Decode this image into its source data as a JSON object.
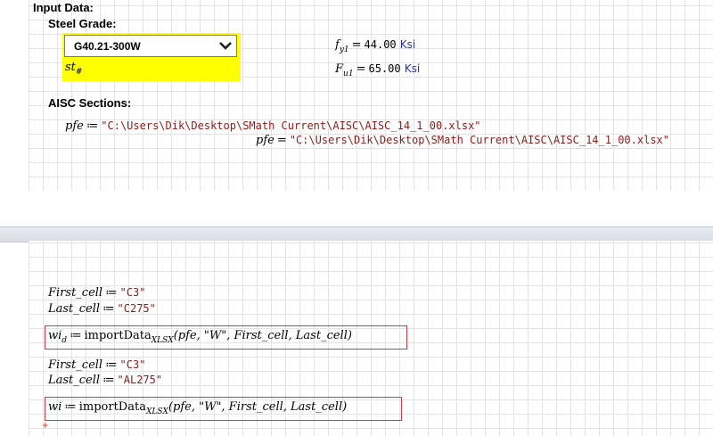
{
  "input_section": {
    "heading": "Input Data:",
    "steel_grade_label": "Steel Grade:",
    "steel_grade_value": "G40.21-300W",
    "st_var": "st",
    "st_sub": "#",
    "fy": {
      "name": "f",
      "sub": "y1",
      "value": "44.00",
      "unit": "Ksi"
    },
    "fu": {
      "name": "F",
      "sub": "u1",
      "value": "65.00",
      "unit": "Ksi"
    },
    "aisc_label": "AISC Sections:",
    "pfe_def": {
      "name": "pfe",
      "op": "≔",
      "value": "\"C:\\Users\\Dik\\Desktop\\SMath Current\\AISC\\AISC_14_1_00.xlsx\""
    },
    "pfe_eval": {
      "name": "pfe",
      "op": "=",
      "value": "\"C:\\Users\\Dik\\Desktop\\SMath Current\\AISC\\AISC_14_1_00.xlsx\""
    }
  },
  "worksheet": {
    "first_cell_1": {
      "name": "First_cell",
      "op": "≔",
      "value": "\"C3\""
    },
    "last_cell_1": {
      "name": "Last_cell",
      "op": "≔",
      "value": "\"C275\""
    },
    "wid_expr": {
      "name": "wi",
      "sub": "d",
      "op": "≔",
      "func": "importData",
      "func_sub": "XLSX",
      "args": "(pfe, \"W\", First_cell, Last_cell)"
    },
    "first_cell_2": {
      "name": "First_cell",
      "op": "≔",
      "value": "\"C3\""
    },
    "last_cell_2": {
      "name": "Last_cell",
      "op": "≔",
      "value": "\"AL275\""
    },
    "wi_expr": {
      "name": "wi",
      "op": "≔",
      "func": "importData",
      "func_sub": "XLSX",
      "args": "(pfe, \"W\", First_cell, Last_cell)"
    },
    "insert_marker": "+"
  }
}
